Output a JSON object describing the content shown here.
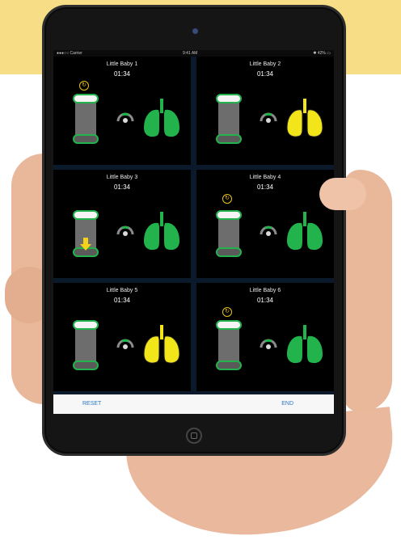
{
  "status_bar": {
    "carrier": "●●●○○ Carrier",
    "time": "9:41 AM",
    "battery": "✱ 42% ▭"
  },
  "babies": [
    {
      "name": "Little Baby 1",
      "time": "01:34",
      "lung_color": "#22b34c",
      "breath_indicator": true,
      "compression_state": "released",
      "arrow": false
    },
    {
      "name": "Little Baby 2",
      "time": "01:34",
      "lung_color": "#f2e51a",
      "breath_indicator": false,
      "compression_state": "released",
      "arrow": false
    },
    {
      "name": "Little Baby 3",
      "time": "01:34",
      "lung_color": "#22b34c",
      "breath_indicator": false,
      "compression_state": "half",
      "arrow": true
    },
    {
      "name": "Little Baby 4",
      "time": "01:34",
      "lung_color": "#22b34c",
      "breath_indicator": true,
      "compression_state": "half",
      "arrow": false
    },
    {
      "name": "Little Baby 5",
      "time": "01:34",
      "lung_color": "#f2e51a",
      "breath_indicator": false,
      "compression_state": "released",
      "arrow": false
    },
    {
      "name": "Little Baby 6",
      "time": "01:34",
      "lung_color": "#22b34c",
      "breath_indicator": true,
      "compression_state": "released",
      "arrow": false
    }
  ],
  "footer": {
    "reset_label": "RESET",
    "end_label": "END"
  },
  "colors": {
    "ok_green": "#22b34c",
    "warning_yellow": "#f2e51a",
    "link_blue": "#2b78c5"
  }
}
